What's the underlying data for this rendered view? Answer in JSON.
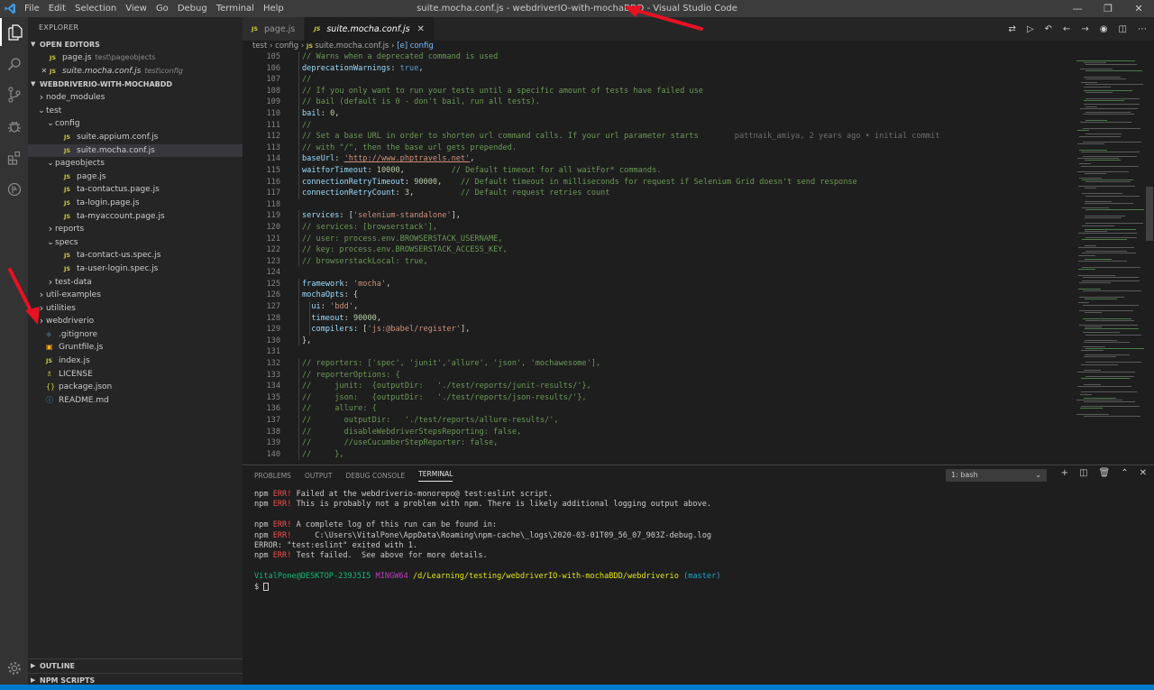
{
  "titlebar": {
    "menus": [
      "File",
      "Edit",
      "Selection",
      "View",
      "Go",
      "Debug",
      "Terminal",
      "Help"
    ],
    "window_title": "suite.mocha.conf.js - webdriverIO-with-mochaBDD - Visual Studio Code"
  },
  "sidebar": {
    "title": "EXPLORER",
    "open_editors_label": "OPEN EDITORS",
    "open_editors": [
      {
        "name": "page.js",
        "path": "test\\pageobjects"
      },
      {
        "name": "suite.mocha.conf.js",
        "path": "test\\config"
      }
    ],
    "project_label": "WEBDRIVERIO-WITH-MOCHABDD",
    "tree": [
      {
        "label": "node_modules",
        "type": "folder",
        "open": false,
        "depth": 0
      },
      {
        "label": "test",
        "type": "folder",
        "open": true,
        "depth": 0
      },
      {
        "label": "config",
        "type": "folder",
        "open": true,
        "depth": 1
      },
      {
        "label": "suite.appium.conf.js",
        "type": "js",
        "depth": 2
      },
      {
        "label": "suite.mocha.conf.js",
        "type": "js",
        "depth": 2,
        "selected": true
      },
      {
        "label": "pageobjects",
        "type": "folder",
        "open": true,
        "depth": 1
      },
      {
        "label": "page.js",
        "type": "js",
        "depth": 2
      },
      {
        "label": "ta-contactus.page.js",
        "type": "js",
        "depth": 2
      },
      {
        "label": "ta-login.page.js",
        "type": "js",
        "depth": 2
      },
      {
        "label": "ta-myaccount.page.js",
        "type": "js",
        "depth": 2
      },
      {
        "label": "reports",
        "type": "folder",
        "open": false,
        "depth": 1
      },
      {
        "label": "specs",
        "type": "folder",
        "open": true,
        "depth": 1
      },
      {
        "label": "ta-contact-us.spec.js",
        "type": "js",
        "depth": 2
      },
      {
        "label": "ta-user-login.spec.js",
        "type": "js",
        "depth": 2
      },
      {
        "label": "test-data",
        "type": "folder",
        "open": false,
        "depth": 1
      },
      {
        "label": "util-examples",
        "type": "folder",
        "open": false,
        "depth": 0
      },
      {
        "label": "utilities",
        "type": "folder",
        "open": false,
        "depth": 0
      },
      {
        "label": "webdriverio",
        "type": "folder",
        "open": false,
        "depth": 0
      },
      {
        "label": ".gitignore",
        "type": "git",
        "depth": 0
      },
      {
        "label": "Gruntfile.js",
        "type": "grunt",
        "depth": 0
      },
      {
        "label": "index.js",
        "type": "js",
        "depth": 0
      },
      {
        "label": "LICENSE",
        "type": "license",
        "depth": 0
      },
      {
        "label": "package.json",
        "type": "json",
        "depth": 0
      },
      {
        "label": "README.md",
        "type": "info",
        "depth": 0
      }
    ],
    "outline_label": "OUTLINE",
    "npm_label": "NPM SCRIPTS"
  },
  "editor": {
    "tabs": [
      {
        "label": "page.js",
        "active": false
      },
      {
        "label": "suite.mocha.conf.js",
        "active": true
      }
    ],
    "breadcrumb": [
      "test",
      "config",
      "suite.mocha.conf.js",
      "[e] config"
    ],
    "blame": "pattnaik_amiya, 2 years ago • initial commit",
    "lines": [
      {
        "n": "105",
        "indent": 1,
        "parts": [
          [
            "c",
            "// Warns when a deprecated command is used"
          ]
        ]
      },
      {
        "n": "106",
        "indent": 1,
        "parts": [
          [
            "p",
            "deprecationWarnings"
          ],
          [
            "d",
            ": "
          ],
          [
            "k",
            "true"
          ],
          [
            "d",
            ","
          ]
        ]
      },
      {
        "n": "107",
        "indent": 1,
        "parts": [
          [
            "c",
            "//"
          ]
        ]
      },
      {
        "n": "108",
        "indent": 1,
        "parts": [
          [
            "c",
            "// If you only want to run your tests until a specific amount of tests have failed use"
          ]
        ]
      },
      {
        "n": "109",
        "indent": 1,
        "parts": [
          [
            "c",
            "// bail (default is 0 - don't bail, run all tests)."
          ]
        ]
      },
      {
        "n": "110",
        "indent": 1,
        "parts": [
          [
            "p",
            "bail"
          ],
          [
            "d",
            ": "
          ],
          [
            "n",
            "0"
          ],
          [
            "d",
            ","
          ]
        ]
      },
      {
        "n": "111",
        "indent": 1,
        "parts": [
          [
            "c",
            "//"
          ]
        ]
      },
      {
        "n": "112",
        "indent": 1,
        "parts": [
          [
            "c",
            "// Set a base URL in order to shorten url command calls. If your url parameter starts"
          ]
        ],
        "blame": true
      },
      {
        "n": "113",
        "indent": 1,
        "parts": [
          [
            "c",
            "// with \"/\", then the base url gets prepended."
          ]
        ]
      },
      {
        "n": "114",
        "indent": 1,
        "parts": [
          [
            "p",
            "baseUrl"
          ],
          [
            "d",
            ": "
          ],
          [
            "su",
            "'http://www.phptravels.net'"
          ],
          [
            "d",
            ","
          ]
        ]
      },
      {
        "n": "115",
        "indent": 1,
        "parts": [
          [
            "p",
            "waitforTimeout"
          ],
          [
            "d",
            ": "
          ],
          [
            "n",
            "10000"
          ],
          [
            "d",
            ",          "
          ],
          [
            "c",
            "// Default timeout for all waitFor* commands."
          ]
        ]
      },
      {
        "n": "116",
        "indent": 1,
        "parts": [
          [
            "p",
            "connectionRetryTimeout"
          ],
          [
            "d",
            ": "
          ],
          [
            "n",
            "90000"
          ],
          [
            "d",
            ",    "
          ],
          [
            "c",
            "// Default timeout in milliseconds for request if Selenium Grid doesn't send response"
          ]
        ]
      },
      {
        "n": "117",
        "indent": 1,
        "parts": [
          [
            "p",
            "connectionRetryCount"
          ],
          [
            "d",
            ": "
          ],
          [
            "n",
            "3"
          ],
          [
            "d",
            ",          "
          ],
          [
            "c",
            "// Default request retries count"
          ]
        ]
      },
      {
        "n": "118",
        "indent": 0,
        "parts": []
      },
      {
        "n": "119",
        "indent": 1,
        "parts": [
          [
            "p",
            "services"
          ],
          [
            "d",
            ": ["
          ],
          [
            "s",
            "'selenium-standalone'"
          ],
          [
            "d",
            "],"
          ]
        ]
      },
      {
        "n": "120",
        "indent": 1,
        "parts": [
          [
            "c",
            "// services: [browserstack'],"
          ]
        ]
      },
      {
        "n": "121",
        "indent": 1,
        "parts": [
          [
            "c",
            "// user: process.env.BROWSERSTACK_USERNAME,"
          ]
        ]
      },
      {
        "n": "122",
        "indent": 1,
        "parts": [
          [
            "c",
            "// key: process.env.BROWSERSTACK_ACCESS_KEY,"
          ]
        ]
      },
      {
        "n": "123",
        "indent": 1,
        "parts": [
          [
            "c",
            "// browserstackLocal: true,"
          ]
        ]
      },
      {
        "n": "124",
        "indent": 0,
        "parts": []
      },
      {
        "n": "125",
        "indent": 1,
        "parts": [
          [
            "p",
            "framework"
          ],
          [
            "d",
            ": "
          ],
          [
            "s",
            "'mocha'"
          ],
          [
            "d",
            ","
          ]
        ]
      },
      {
        "n": "126",
        "indent": 1,
        "parts": [
          [
            "p",
            "mochaOpts"
          ],
          [
            "d",
            ": {"
          ]
        ]
      },
      {
        "n": "127",
        "indent": 2,
        "parts": [
          [
            "p",
            "ui"
          ],
          [
            "d",
            ": "
          ],
          [
            "s",
            "'bdd'"
          ],
          [
            "d",
            ","
          ]
        ]
      },
      {
        "n": "128",
        "indent": 2,
        "parts": [
          [
            "p",
            "timeout"
          ],
          [
            "d",
            ": "
          ],
          [
            "n",
            "90000"
          ],
          [
            "d",
            ","
          ]
        ]
      },
      {
        "n": "129",
        "indent": 2,
        "parts": [
          [
            "p",
            "compilers"
          ],
          [
            "d",
            ": ["
          ],
          [
            "s",
            "'js:@babel/register'"
          ],
          [
            "d",
            "],"
          ]
        ]
      },
      {
        "n": "130",
        "indent": 1,
        "parts": [
          [
            "d",
            "},"
          ]
        ]
      },
      {
        "n": "131",
        "indent": 0,
        "parts": []
      },
      {
        "n": "132",
        "indent": 1,
        "parts": [
          [
            "c",
            "// reporters: ['spec', 'junit','allure', 'json', 'mochawesome'],"
          ]
        ]
      },
      {
        "n": "133",
        "indent": 1,
        "parts": [
          [
            "c",
            "// reporterOptions: {"
          ]
        ]
      },
      {
        "n": "134",
        "indent": 1,
        "parts": [
          [
            "c",
            "//     junit:  {outputDir:   './test/reports/junit-results/'},"
          ]
        ]
      },
      {
        "n": "135",
        "indent": 1,
        "parts": [
          [
            "c",
            "//     json:   {outputDir:   './test/reports/json-results/'},"
          ]
        ]
      },
      {
        "n": "136",
        "indent": 1,
        "parts": [
          [
            "c",
            "//     allure: {"
          ]
        ]
      },
      {
        "n": "137",
        "indent": 1,
        "parts": [
          [
            "c",
            "//       outputDir:   './test/reports/allure-results/',"
          ]
        ]
      },
      {
        "n": "138",
        "indent": 1,
        "parts": [
          [
            "c",
            "//       disableWebdriverStepsReporting: false,"
          ]
        ]
      },
      {
        "n": "139",
        "indent": 1,
        "parts": [
          [
            "c",
            "//       //useCucumberStepReporter: false,"
          ]
        ]
      },
      {
        "n": "140",
        "indent": 1,
        "parts": [
          [
            "c",
            "//     },"
          ]
        ]
      }
    ]
  },
  "panel": {
    "tabs": [
      "PROBLEMS",
      "OUTPUT",
      "DEBUG CONSOLE",
      "TERMINAL"
    ],
    "active_tab": "TERMINAL",
    "terminal_select": "1: bash",
    "terminal_lines": [
      [
        [
          "d",
          "npm "
        ],
        [
          "e",
          "ERR!"
        ],
        [
          "d",
          " Failed at the webdriverio-monorepo@ test:eslint script."
        ]
      ],
      [
        [
          "d",
          "npm "
        ],
        [
          "e",
          "ERR!"
        ],
        [
          "d",
          " This is probably not a problem with npm. There is likely additional logging output above."
        ]
      ],
      [],
      [
        [
          "d",
          "npm "
        ],
        [
          "e",
          "ERR!"
        ],
        [
          "d",
          " A complete log of this run can be found in:"
        ]
      ],
      [
        [
          "d",
          "npm "
        ],
        [
          "e",
          "ERR!"
        ],
        [
          "d",
          "     C:\\Users\\VitalPone\\AppData\\Roaming\\npm-cache\\_logs\\2020-03-01T09_56_07_903Z-debug.log"
        ]
      ],
      [
        [
          "d",
          "ERROR: \"test:eslint\" exited with 1."
        ]
      ],
      [
        [
          "d",
          "npm "
        ],
        [
          "e",
          "ERR!"
        ],
        [
          "d",
          " Test failed.  See above for more details."
        ]
      ],
      [],
      [
        [
          "g",
          "VitalPone@DESKTOP-239J5I5"
        ],
        [
          "d",
          " "
        ],
        [
          "m",
          "MINGW64"
        ],
        [
          "d",
          " "
        ],
        [
          "y",
          "/d/Learning/testing/webdriverIO-with-mochaBDD/webdriverio"
        ],
        [
          "d",
          " "
        ],
        [
          "c",
          "(master)"
        ]
      ],
      [
        [
          "d",
          "$ "
        ],
        [
          "cur",
          ""
        ]
      ]
    ]
  }
}
